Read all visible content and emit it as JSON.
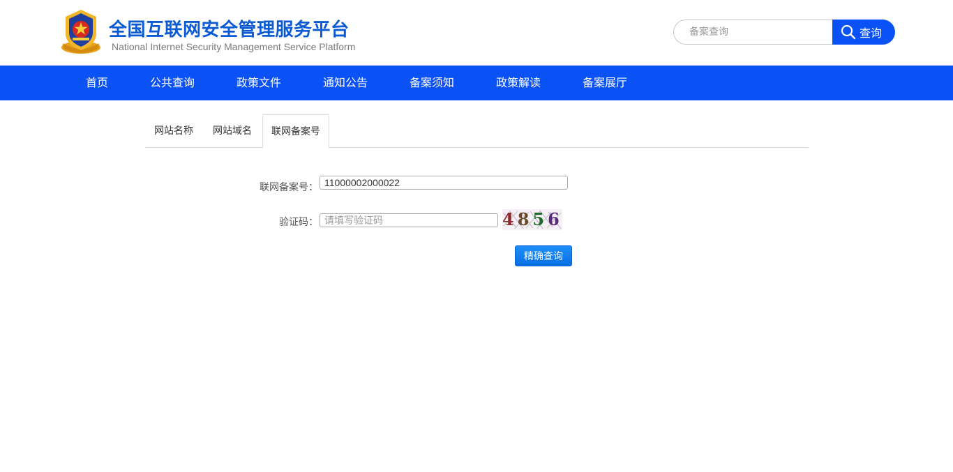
{
  "header": {
    "title": "全国互联网安全管理服务平台",
    "subtitle": "National Internet Security Management Service Platform",
    "emblem_icon": "police-emblem-icon"
  },
  "search": {
    "placeholder": "备案查询",
    "value": "",
    "button_label": "查询",
    "icon": "search-icon"
  },
  "nav": {
    "items": [
      {
        "label": "首页"
      },
      {
        "label": "公共查询"
      },
      {
        "label": "政策文件"
      },
      {
        "label": "通知公告"
      },
      {
        "label": "备案须知"
      },
      {
        "label": "政策解读"
      },
      {
        "label": "备案展厅"
      }
    ]
  },
  "tabs": {
    "items": [
      {
        "label": "网站名称",
        "active": false
      },
      {
        "label": "网站域名",
        "active": false
      },
      {
        "label": "联网备案号",
        "active": true
      }
    ]
  },
  "form": {
    "record_label": "联网备案号：",
    "record_value": "11000002000022",
    "captcha_label": "验证码：",
    "captcha_placeholder": "请填写验证码",
    "captcha_value": "",
    "captcha_text": "4856",
    "submit_label": "精确查询"
  },
  "colors": {
    "brand_blue": "#0a52f5",
    "title_blue": "#0a5ad4",
    "button_blue": "#1d8ff5"
  }
}
